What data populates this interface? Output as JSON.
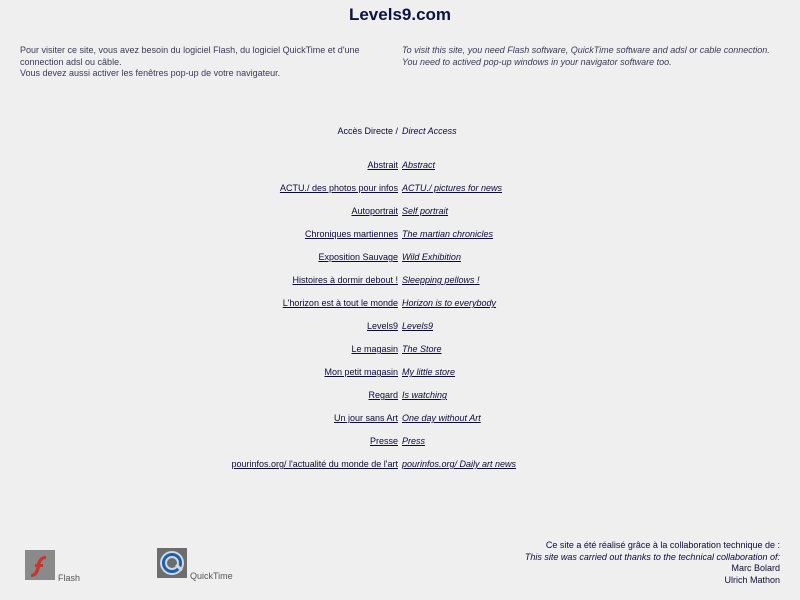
{
  "header": {
    "title": "Levels9.com"
  },
  "intro": {
    "fr_line1": "Pour visiter ce site, vous avez besoin du logiciel Flash, du logiciel QuickTime et d'une connection adsl ou câble.",
    "fr_line2": "Vous devez aussi activer les fenêtres pop-up de votre navigateur.",
    "en_line1": "To visit this site, you need Flash software, QuickTime software and adsl or cable connection.",
    "en_line2": "You need to actived pop-up windows in your navigator software too."
  },
  "access": {
    "fr": "Accès Directe /",
    "en": "Direct Access"
  },
  "links": [
    {
      "fr": "Abstrait",
      "en": "Abstract"
    },
    {
      "fr": "ACTU./ des photos pour infos",
      "en": "ACTU./ pictures for news"
    },
    {
      "fr": "Autoportrait",
      "en": "Self portrait"
    },
    {
      "fr": "Chroniques martiennes",
      "en": "The martian chronicles"
    },
    {
      "fr": "Exposition Sauvage",
      "en": "Wild Exhibition"
    },
    {
      "fr": "Histoires à dormir debout !",
      "en": "Sleepping pellows !"
    },
    {
      "fr": "L'horizon est à tout le monde",
      "en": "Horizon is to everybody"
    },
    {
      "fr": "Levels9",
      "en": "Levels9"
    },
    {
      "fr": "Le magasin",
      "en": "The Store"
    },
    {
      "fr": "Mon petit magasin",
      "en": "My little store"
    },
    {
      "fr": "Regard",
      "en": "Is watching"
    },
    {
      "fr": "Un jour sans Art",
      "en": "One day without Art"
    },
    {
      "fr": "Presse",
      "en": "Press"
    },
    {
      "fr": "pourinfos.org/ l'actualité du monde de l'art",
      "en": "pourinfos.org/ Daily art news"
    }
  ],
  "credits": {
    "fr": "Ce site a été réalisé grâce à la collaboration technique de :",
    "en": "This site was carried out thanks to the technical collaboration of:",
    "name1": "Marc Bolard",
    "name2": "Ulrich Mathon"
  },
  "plugins": {
    "flash": {
      "label": "Flash",
      "icon": "flash-icon",
      "color": "#c0392b"
    },
    "quicktime": {
      "label": "QuickTime",
      "icon": "quicktime-icon",
      "color": "#1f5fa8"
    }
  }
}
